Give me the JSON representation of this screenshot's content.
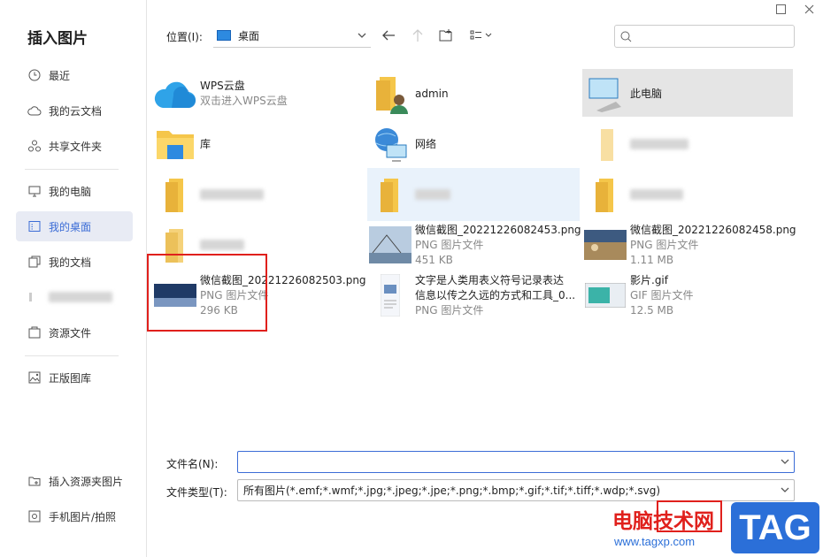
{
  "dialog": {
    "title": "插入图片"
  },
  "sidebar": {
    "items": [
      {
        "label": "最近",
        "icon": "clock-icon"
      },
      {
        "label": "我的云文档",
        "icon": "cloud-icon"
      },
      {
        "label": "共享文件夹",
        "icon": "share-icon"
      },
      {
        "label": "我的电脑",
        "icon": "monitor-icon"
      },
      {
        "label": "我的桌面",
        "icon": "desktop-icon",
        "active": true
      },
      {
        "label": "我的文档",
        "icon": "documents-icon"
      },
      {
        "label": "资源文件",
        "icon": "resource-icon"
      },
      {
        "label": "正版图库",
        "icon": "gallery-icon"
      },
      {
        "label": "插入资源夹图片",
        "icon": "insert-folder-icon"
      },
      {
        "label": "手机图片/拍照",
        "icon": "phone-photo-icon"
      }
    ]
  },
  "toolbar": {
    "location_label": "位置(I):",
    "location_value": "桌面"
  },
  "files": [
    {
      "name": "WPS云盘",
      "sub1": "双击进入WPS云盘",
      "sub2": ""
    },
    {
      "name": "admin",
      "sub1": "",
      "sub2": ""
    },
    {
      "name": "此电脑",
      "sub1": "",
      "sub2": ""
    },
    {
      "name": "库",
      "sub1": "",
      "sub2": ""
    },
    {
      "name": "网络",
      "sub1": "",
      "sub2": ""
    },
    {
      "name": "微信截图_20221226082453.png",
      "sub1": "PNG 图片文件",
      "sub2": "451 KB"
    },
    {
      "name": "微信截图_20221226082458.png",
      "sub1": "PNG 图片文件",
      "sub2": "1.11 MB"
    },
    {
      "name": "微信截图_20221226082503.png",
      "sub1": "PNG 图片文件",
      "sub2": "296 KB"
    },
    {
      "name": "文字是人类用表义符号记录表达",
      "name2": "信息以传之久远的方式和工具_0...",
      "sub1": "PNG 图片文件",
      "sub2": ""
    },
    {
      "name": "影片.gif",
      "sub1": "GIF 图片文件",
      "sub2": "12.5 MB"
    }
  ],
  "form": {
    "filename_label": "文件名(N):",
    "filename_value": "",
    "filetype_label": "文件类型(T):",
    "filetype_value": "所有图片(*.emf;*.wmf;*.jpg;*.jpeg;*.jpe;*.png;*.bmp;*.gif;*.tif;*.tiff;*.wdp;*.svg)"
  },
  "watermark": {
    "text": "电脑技术网",
    "url": "www.tagxp.com",
    "tag": "TAG"
  },
  "colors": {
    "accent": "#3b6cd6",
    "highlight": "#e0201c",
    "folder": "#f5c64a"
  }
}
